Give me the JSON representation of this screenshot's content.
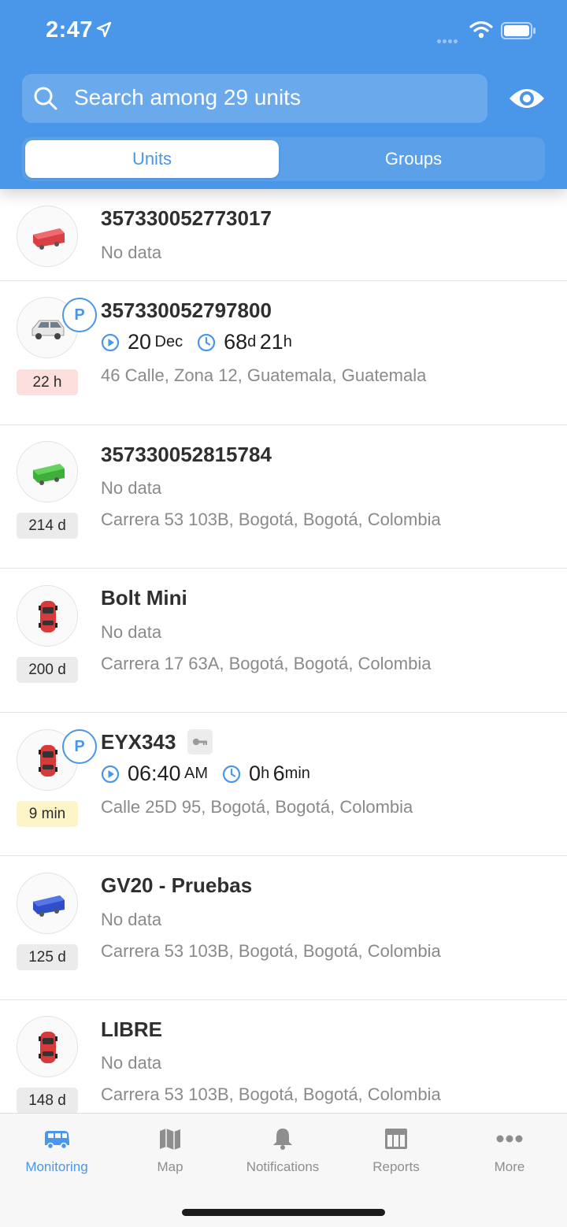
{
  "status": {
    "time": "2:47"
  },
  "search": {
    "placeholder": "Search among 29 units"
  },
  "segments": {
    "units": "Units",
    "groups": "Groups",
    "selected": "Units"
  },
  "units": [
    {
      "name": "357330052773017",
      "sub": "No data",
      "address": "",
      "badge": "",
      "icon": "red-trailer-icon",
      "parked": false
    },
    {
      "name": "357330052797800",
      "address": "46 Calle, Zona 12, Guatemala, Guatemala",
      "badge": "22 h",
      "icon": "white-van-icon",
      "parked": true,
      "start_day": "20",
      "start_unit": "Dec",
      "dur_days": "68",
      "dur_days_unit": "d",
      "dur_hours": "21",
      "dur_hours_unit": "h"
    },
    {
      "name": "357330052815784",
      "sub": "No data",
      "address": "Carrera 53 103B, Bogotá, Bogotá, Colombia",
      "badge": "214 d",
      "icon": "green-trailer-icon",
      "parked": false
    },
    {
      "name": "Bolt Mini",
      "sub": "No data",
      "address": "Carrera 17 63A, Bogotá, Bogotá, Colombia",
      "badge": "200 d",
      "icon": "red-car-icon",
      "parked": false
    },
    {
      "name": "EYX343",
      "address": "Calle 25D 95, Bogotá, Bogotá, Colombia",
      "badge": "9 min",
      "icon": "red-car-icon",
      "parked": true,
      "start_time": "06:40",
      "start_ampm": "AM",
      "dur_h": "0",
      "dur_h_unit": "h",
      "dur_min": "6",
      "dur_min_unit": "min"
    },
    {
      "name": "GV20 - Pruebas",
      "sub": "No data",
      "address": "Carrera 53 103B, Bogotá, Bogotá, Colombia",
      "badge": "125 d",
      "icon": "blue-trailer-icon",
      "parked": false
    },
    {
      "name": "LIBRE",
      "sub": "No data",
      "address": "Carrera 53 103B, Bogotá, Bogotá, Colombia",
      "badge": "148 d",
      "icon": "red-car-icon",
      "parked": false
    }
  ],
  "parking_label": "P",
  "tabs": [
    {
      "label": "Monitoring",
      "icon": "van-icon",
      "active": true
    },
    {
      "label": "Map",
      "icon": "map-icon",
      "active": false
    },
    {
      "label": "Notifications",
      "icon": "bell-icon",
      "active": false
    },
    {
      "label": "Reports",
      "icon": "table-icon",
      "active": false
    },
    {
      "label": "More",
      "icon": "ellipsis-icon",
      "active": false
    }
  ],
  "colors": {
    "accent": "#4a96e8",
    "badge_red": "#fde0dd",
    "badge_gray": "#ebebeb",
    "badge_yellow": "#fdf5c8"
  }
}
